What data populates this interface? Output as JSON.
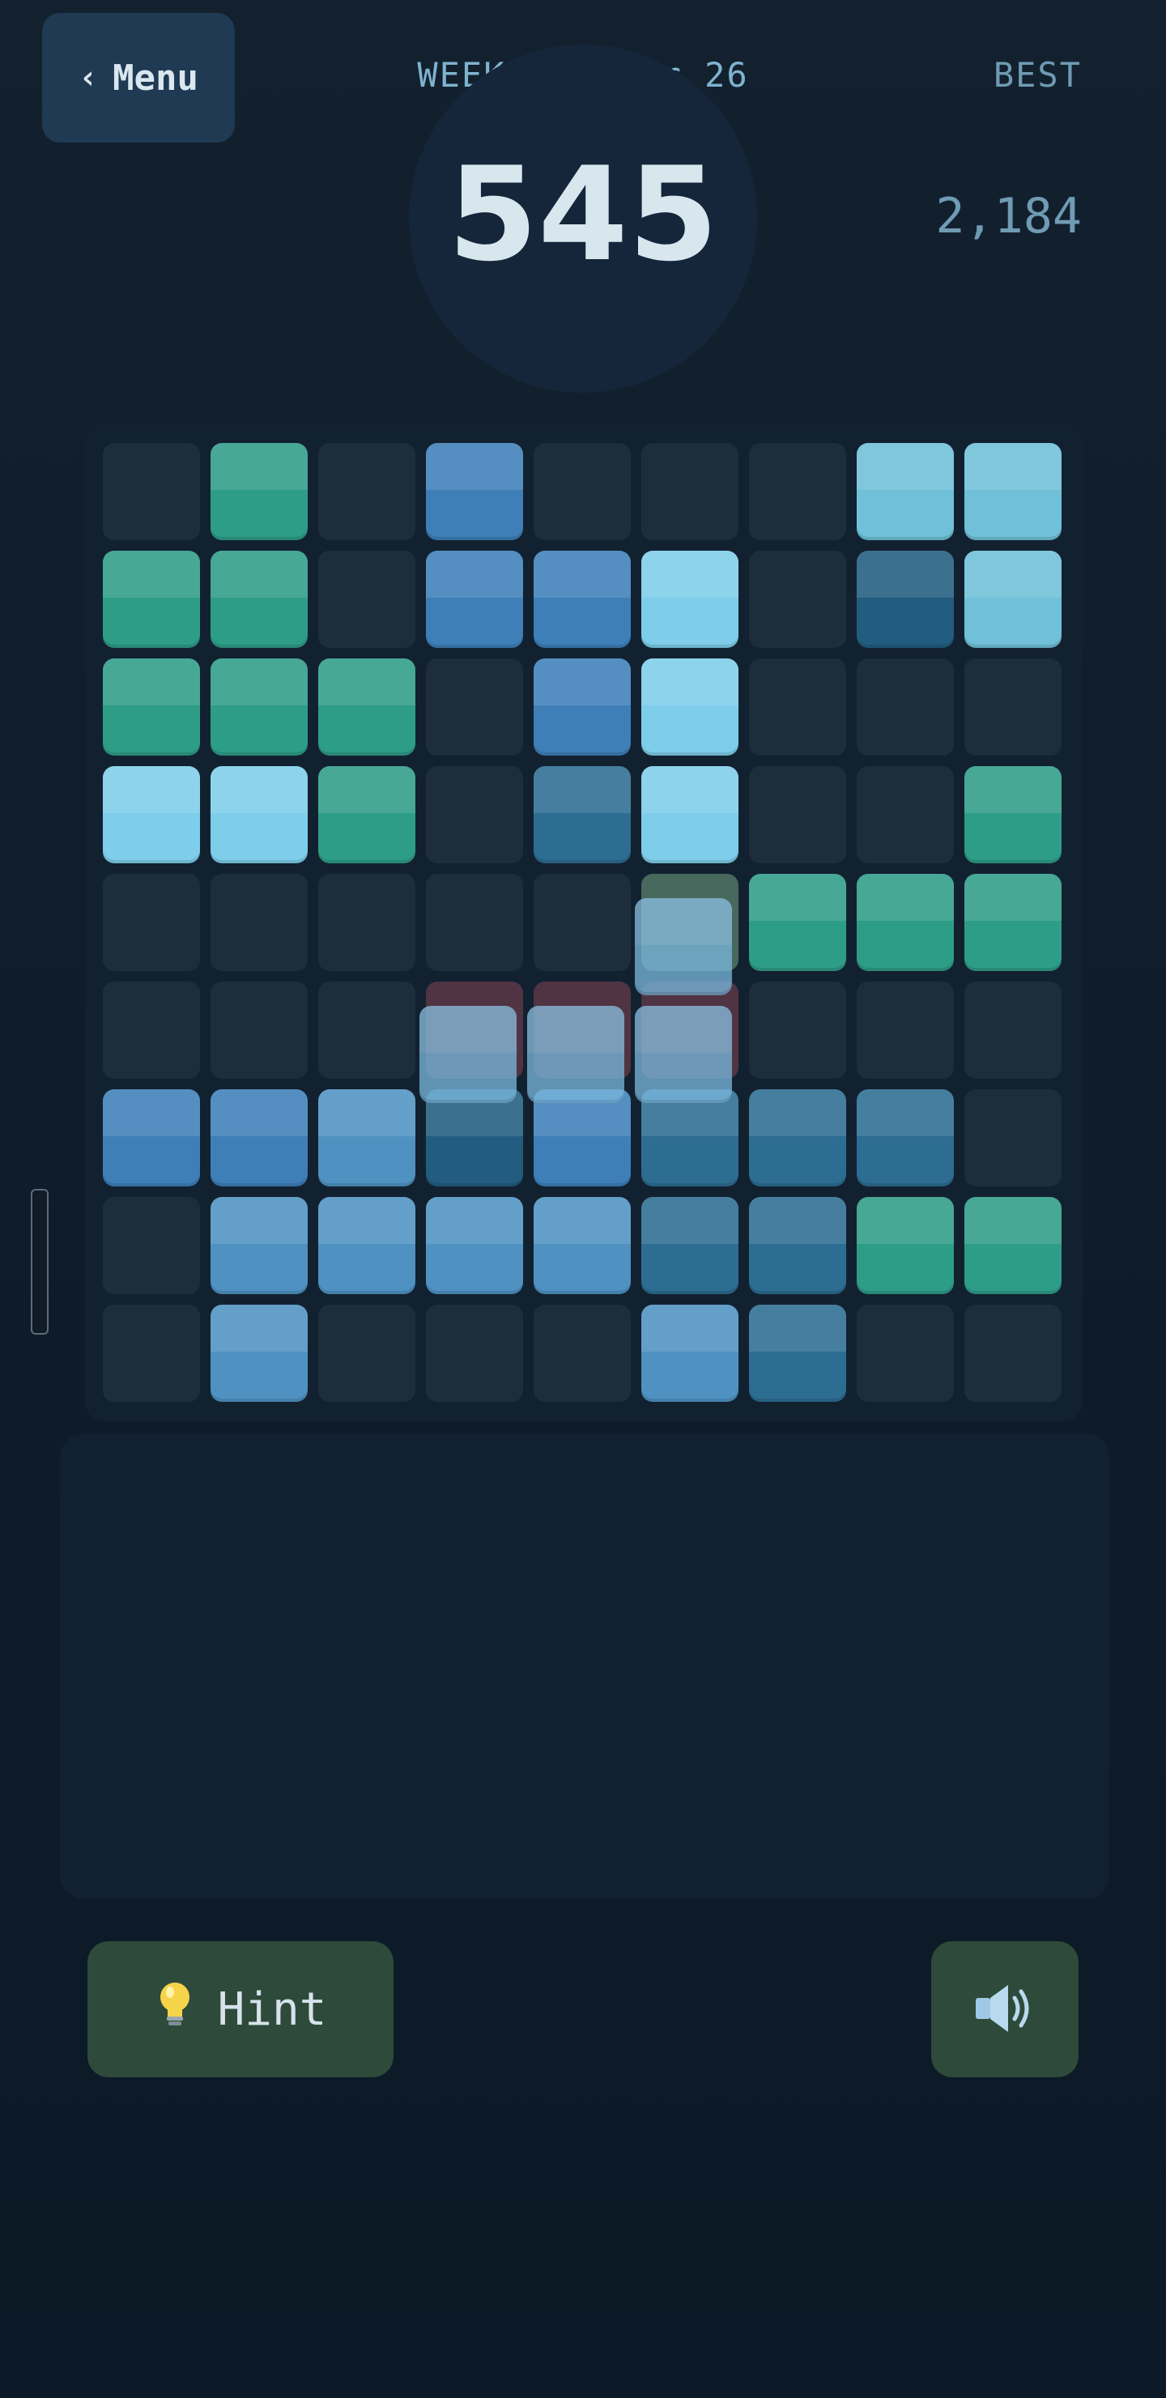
{
  "header": {
    "menu_label": "Menu",
    "menu_icon": "chevron-left-icon",
    "mode_label": "WEEKLY · Apr 26",
    "best_label": "BEST",
    "best_value": "2,184",
    "score": "545"
  },
  "board": {
    "rows": 9,
    "cols": 9,
    "palette": {
      "T": "#2e9d87",
      "B": "#3e7fb8",
      "L": "#7ecdea",
      "A": "#6fc0d8",
      "D": "#225d80",
      "M": "#2d6d92",
      "S": "#4f92c2"
    },
    "grid": [
      ".T.B...AA",
      "TT.BBL.DA",
      "TTT.BL...",
      "LLT.ML..T",
      ".....GTTT",
      ".........",
      "BBSDBMMM.",
      ".SSSSMMTT",
      ".S...SM.."
    ],
    "ghost_highlight": {
      "green_cells": [
        [
          4,
          5
        ]
      ],
      "red_cells": [
        [
          5,
          3
        ],
        [
          5,
          4
        ],
        [
          5,
          5
        ]
      ],
      "green_color": "#6a9a78",
      "red_color": "#7a3a48"
    },
    "dragged_piece": {
      "color": "#7ab8de",
      "cells": [
        [
          4,
          5
        ],
        [
          5,
          3
        ],
        [
          5,
          4
        ],
        [
          5,
          5
        ]
      ]
    }
  },
  "controls": {
    "hint_label": "Hint",
    "hint_icon": "lightbulb-icon",
    "sound_icon": "speaker-icon"
  }
}
